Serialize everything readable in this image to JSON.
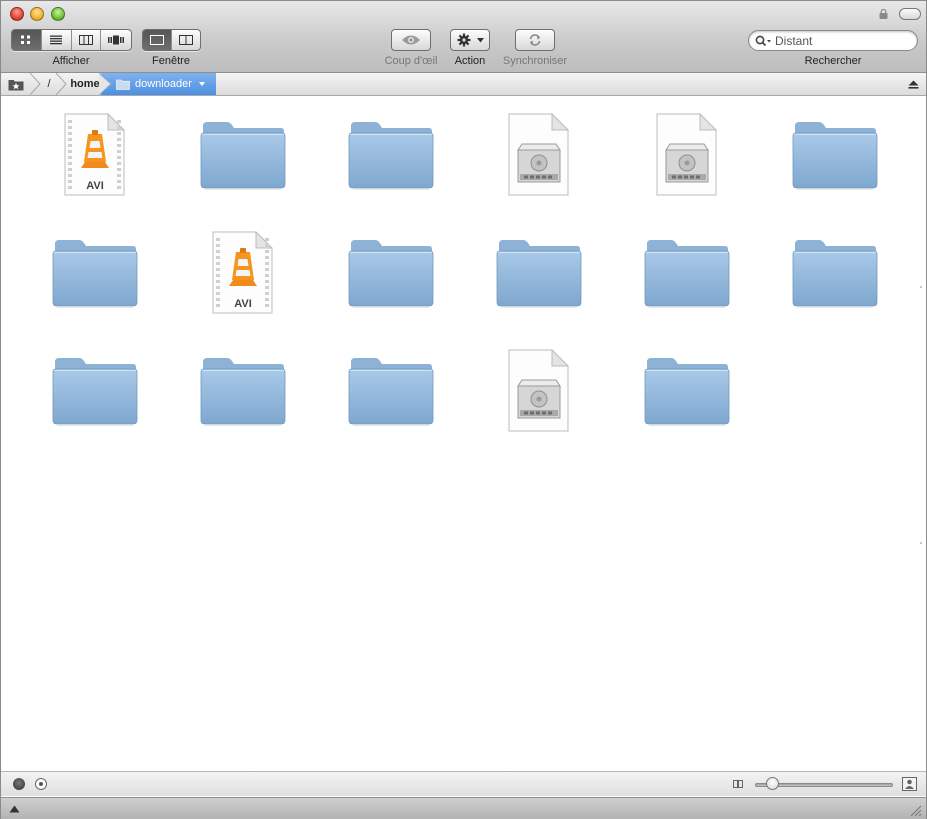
{
  "toolbar": {
    "view_label": "Afficher",
    "window_label": "Fenêtre",
    "quicklook_label": "Coup d'œil",
    "action_label": "Action",
    "sync_label": "Synchroniser",
    "search_label": "Rechercher",
    "search_placeholder": "Distant"
  },
  "pathbar": {
    "items": [
      {
        "label": "/"
      },
      {
        "label": "home"
      },
      {
        "label": "downloader"
      }
    ]
  },
  "files": [
    {
      "type": "avi"
    },
    {
      "type": "folder"
    },
    {
      "type": "folder"
    },
    {
      "type": "disk-image"
    },
    {
      "type": "disk-image"
    },
    {
      "type": "folder"
    },
    {
      "type": "folder"
    },
    {
      "type": "avi"
    },
    {
      "type": "folder"
    },
    {
      "type": "folder"
    },
    {
      "type": "folder"
    },
    {
      "type": "folder"
    },
    {
      "type": "folder"
    },
    {
      "type": "folder"
    },
    {
      "type": "folder"
    },
    {
      "type": "disk-image"
    },
    {
      "type": "folder"
    }
  ],
  "file_badge_text": "AVI",
  "colors": {
    "folder": "#8fb6da",
    "path_current": "#5a97e3",
    "vlc_orange": "#f08a1c"
  },
  "icon_slider": {
    "value": 0.12
  }
}
